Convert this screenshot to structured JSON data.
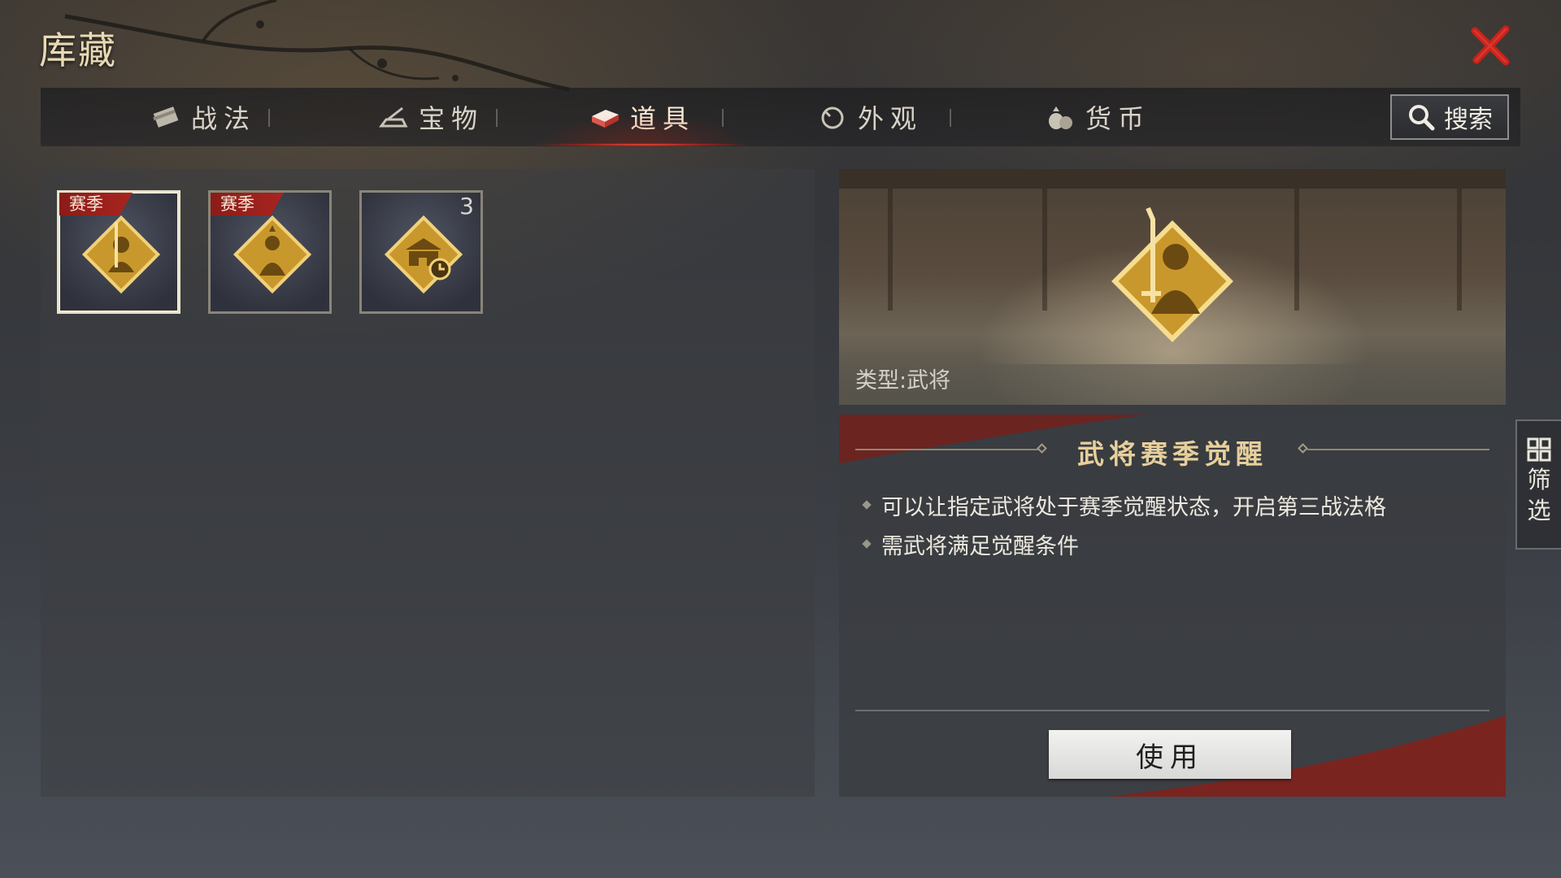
{
  "page": {
    "title": "库藏"
  },
  "tabs": [
    {
      "label": "战法",
      "icon": "tactics-scroll-icon",
      "active": false
    },
    {
      "label": "宝物",
      "icon": "treasure-icon",
      "active": false
    },
    {
      "label": "道具",
      "icon": "item-box-icon",
      "active": true
    },
    {
      "label": "外观",
      "icon": "appearance-icon",
      "active": false
    },
    {
      "label": "货币",
      "icon": "currency-bag-icon",
      "active": false
    }
  ],
  "search": {
    "label": "搜索",
    "icon": "search-icon"
  },
  "items": [
    {
      "badge": "赛季",
      "icon": "general-warrior-emblem-icon",
      "count": "",
      "selected": true
    },
    {
      "badge": "赛季",
      "icon": "general-strategist-emblem-icon",
      "count": "",
      "selected": false
    },
    {
      "badge": "",
      "icon": "city-timer-emblem-icon",
      "count": "3",
      "selected": false
    }
  ],
  "detail": {
    "type_text": "类型:武将",
    "title": "武将赛季觉醒",
    "descriptions": [
      "可以让指定武将处于赛季觉醒状态，开启第三战法格",
      "需武将满足觉醒条件"
    ],
    "use_button": "使用"
  },
  "filter": {
    "label_chars": [
      "筛",
      "选"
    ],
    "icon": "grid-filter-icon"
  },
  "colors": {
    "accent_red": "#c0261e",
    "gold": "#e0b54a",
    "title_gold": "#e7cf9c"
  }
}
